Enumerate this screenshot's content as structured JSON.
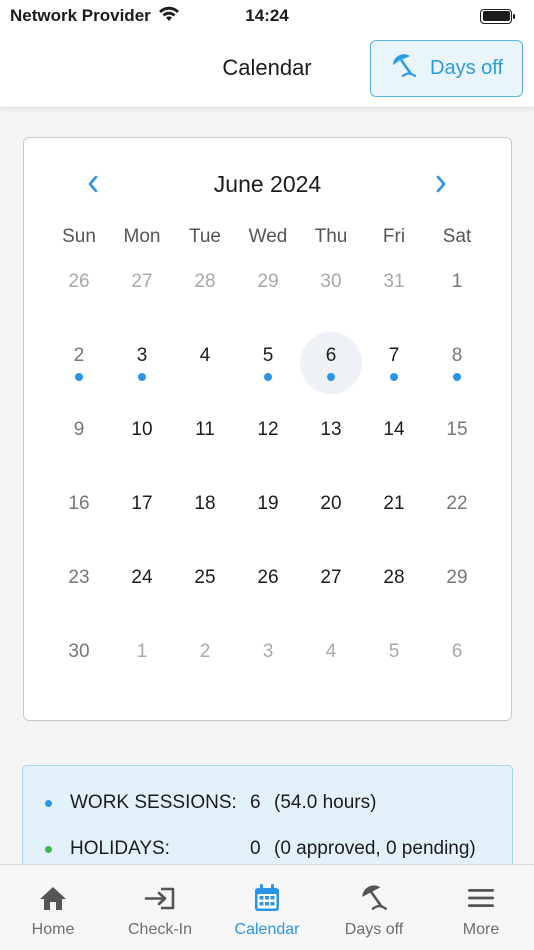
{
  "status_bar": {
    "carrier": "Network Provider",
    "time": "14:24"
  },
  "nav": {
    "title": "Calendar",
    "days_off_button": "Days off"
  },
  "calendar": {
    "month_title": "June 2024",
    "weekdays": [
      "Sun",
      "Mon",
      "Tue",
      "Wed",
      "Thu",
      "Fri",
      "Sat"
    ],
    "weeks": [
      [
        {
          "label": "26",
          "other": true
        },
        {
          "label": "27",
          "other": true
        },
        {
          "label": "28",
          "other": true
        },
        {
          "label": "29",
          "other": true
        },
        {
          "label": "30",
          "other": true
        },
        {
          "label": "31",
          "other": true
        },
        {
          "label": "1",
          "weekend": true
        }
      ],
      [
        {
          "label": "2",
          "weekend": true,
          "dot": true
        },
        {
          "label": "3",
          "dot": true
        },
        {
          "label": "4"
        },
        {
          "label": "5",
          "dot": true
        },
        {
          "label": "6",
          "dot": true,
          "selected": true
        },
        {
          "label": "7",
          "dot": true
        },
        {
          "label": "8",
          "weekend": true,
          "dot": true
        }
      ],
      [
        {
          "label": "9",
          "weekend": true
        },
        {
          "label": "10"
        },
        {
          "label": "11"
        },
        {
          "label": "12"
        },
        {
          "label": "13"
        },
        {
          "label": "14"
        },
        {
          "label": "15",
          "weekend": true
        }
      ],
      [
        {
          "label": "16",
          "weekend": true
        },
        {
          "label": "17"
        },
        {
          "label": "18"
        },
        {
          "label": "19"
        },
        {
          "label": "20"
        },
        {
          "label": "21"
        },
        {
          "label": "22",
          "weekend": true
        }
      ],
      [
        {
          "label": "23",
          "weekend": true
        },
        {
          "label": "24"
        },
        {
          "label": "25"
        },
        {
          "label": "26"
        },
        {
          "label": "27"
        },
        {
          "label": "28"
        },
        {
          "label": "29",
          "weekend": true
        }
      ],
      [
        {
          "label": "30",
          "weekend": true
        },
        {
          "label": "1",
          "other": true
        },
        {
          "label": "2",
          "other": true
        },
        {
          "label": "3",
          "other": true
        },
        {
          "label": "4",
          "other": true
        },
        {
          "label": "5",
          "other": true
        },
        {
          "label": "6",
          "other": true
        }
      ]
    ]
  },
  "summary": {
    "work_sessions": {
      "label": "WORK SESSIONS:",
      "count": "6",
      "detail": "(54.0 hours)",
      "color": "#2a95e8"
    },
    "holidays": {
      "label": "HOLIDAYS:",
      "count": "0",
      "detail": "(0 approved, 0 pending)",
      "color": "#3fb34f"
    }
  },
  "tabs": [
    {
      "label": "Home",
      "icon": "home-icon",
      "active": false
    },
    {
      "label": "Check-In",
      "icon": "check-in-icon",
      "active": false
    },
    {
      "label": "Calendar",
      "icon": "calendar-icon",
      "active": true
    },
    {
      "label": "Days off",
      "icon": "beach-umbrella-icon",
      "active": false
    },
    {
      "label": "More",
      "icon": "menu-icon",
      "active": false
    }
  ],
  "colors": {
    "accent": "#2a95e8",
    "dot": "#2a95e8",
    "holiday": "#3fb34f"
  }
}
